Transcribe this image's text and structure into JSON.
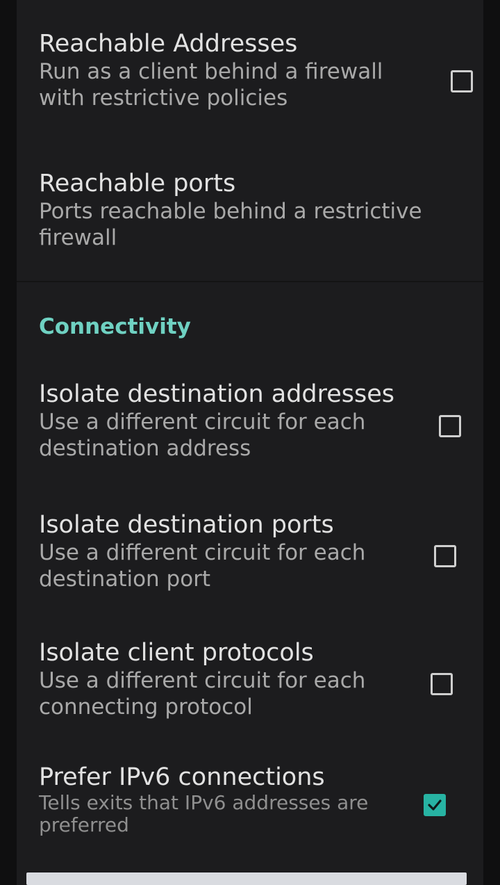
{
  "preferences": {
    "reachable_addresses": {
      "title": "Reachable Addresses",
      "summary": "Run as a client behind a firewall with restrictive policies",
      "checked": false
    },
    "reachable_ports": {
      "title": "Reachable ports",
      "summary": "Ports reachable behind a restrictive firewall"
    }
  },
  "connectivity": {
    "category_title": "Connectivity",
    "isolate_dest_addresses": {
      "title": "Isolate destination addresses",
      "summary": "Use a different circuit for each destination address",
      "checked": false
    },
    "isolate_dest_ports": {
      "title": "Isolate destination ports",
      "summary": "Use a different circuit for each destination port",
      "checked": false
    },
    "isolate_client_protocols": {
      "title": "Isolate client protocols",
      "summary": "Use a different circuit for each connecting protocol",
      "checked": false
    },
    "prefer_ipv6": {
      "title": "Prefer IPv6 connections",
      "summary": "Tells exits that IPv6 addresses are preferred",
      "checked": true
    }
  },
  "colors": {
    "accent": "#27b3a3",
    "category_text": "#6fd1c2",
    "background": "#1c1c1e"
  }
}
